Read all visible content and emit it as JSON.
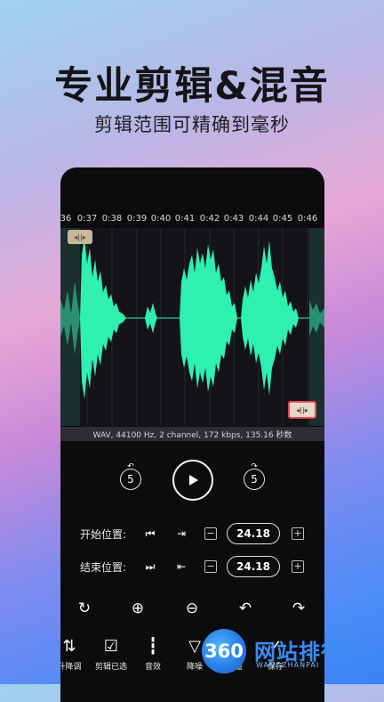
{
  "promo": {
    "headline": "专业剪辑&混音",
    "subline": "剪辑范围可精确到毫秒"
  },
  "timeline": {
    "ticks": [
      "36",
      "0:37",
      "0:38",
      "0:39",
      "0:40",
      "0:41",
      "0:42",
      "0:43",
      "0:44",
      "0:45",
      "0:46"
    ]
  },
  "waveform": {
    "color": "#2ef0b0",
    "start_handle_glyph": "◂||▸",
    "end_handle_glyph": "◂||▸"
  },
  "info_bar": "WAV, 44100 Hz, 2 channel, 172 kbps, 135.16 秒数",
  "controls": {
    "rewind_seconds": "5",
    "forward_seconds": "5"
  },
  "trim": {
    "start_label": "开始位置:",
    "start_value": "24.18",
    "end_label": "结束位置:",
    "end_value": "24.18",
    "minus": "−",
    "plus": "+"
  },
  "bottom_tabs": [
    {
      "label": "升降调",
      "icon": "pitch-icon"
    },
    {
      "label": "剪辑已选",
      "icon": "check-square-icon"
    },
    {
      "label": "音效",
      "icon": "sound-effect-icon"
    },
    {
      "label": "降噪",
      "icon": "denoise-icon"
    },
    {
      "label": "音量",
      "icon": "volume-icon"
    },
    {
      "label": "保存",
      "icon": "save-icon"
    }
  ],
  "watermark": {
    "logo": "360",
    "text": "网站排行榜",
    "sub": "WANGZHANPAI"
  }
}
